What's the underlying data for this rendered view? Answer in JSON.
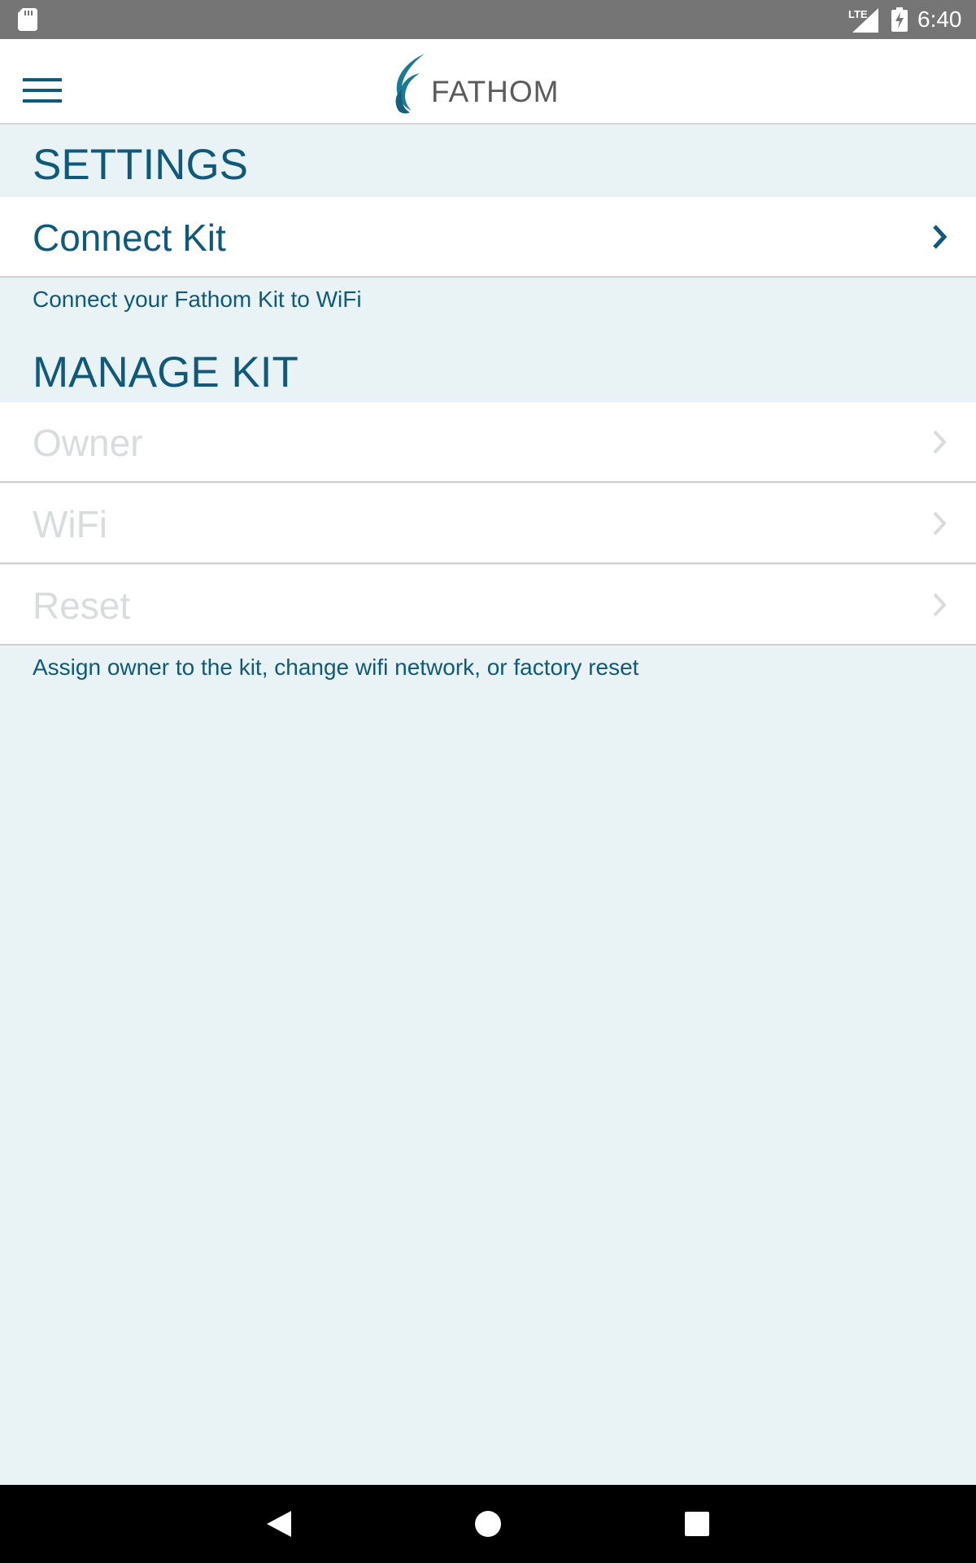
{
  "status_bar": {
    "network_type": "LTE",
    "time": "6:40"
  },
  "header": {
    "logo_text": "FATHOM"
  },
  "sections": {
    "settings": {
      "title": "SETTINGS",
      "rows": [
        {
          "label": "Connect Kit",
          "enabled": true
        }
      ],
      "caption": "Connect your Fathom Kit to WiFi"
    },
    "manage_kit": {
      "title": "MANAGE KIT",
      "rows": [
        {
          "label": "Owner",
          "enabled": false
        },
        {
          "label": "WiFi",
          "enabled": false
        },
        {
          "label": "Reset",
          "enabled": false
        }
      ],
      "caption": "Assign owner to the kit, change wifi network, or factory reset"
    }
  },
  "colors": {
    "brand": "#0f5a7b",
    "background": "#e9f2f5",
    "disabled_text": "#d9dcdd"
  },
  "icons": {
    "menu": "hamburger-menu-icon",
    "chevron": "chevron-right-icon",
    "back": "back-triangle-icon",
    "home": "home-circle-icon",
    "recents": "recents-square-icon"
  }
}
